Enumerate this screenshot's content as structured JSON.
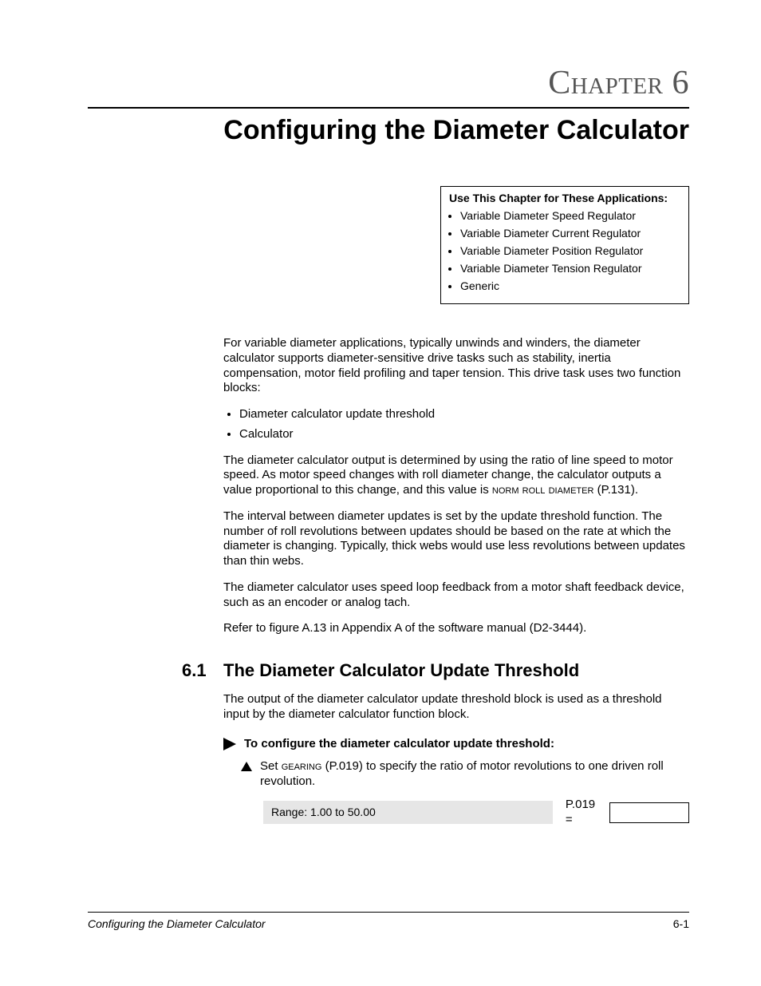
{
  "chapter": {
    "label": "Chapter",
    "number": "6",
    "title": "Configuring the Diameter Calculator"
  },
  "apps_box": {
    "title": "Use This Chapter for These Applications:",
    "items": [
      "Variable Diameter Speed Regulator",
      "Variable Diameter Current Regulator",
      "Variable Diameter Position Regulator",
      "Variable Diameter Tension Regulator",
      "Generic"
    ]
  },
  "intro": {
    "p1": "For variable diameter applications, typically unwinds and winders, the diameter calculator supports diameter-sensitive drive tasks such as stability, inertia compensation, motor field profiling and taper tension. This drive task uses two function blocks:",
    "bullets": [
      "Diameter calculator update threshold",
      "Calculator"
    ],
    "p2a": "The diameter calculator output is determined by using the ratio of line speed to motor speed. As motor speed changes with roll diameter change, the calculator outputs a value proportional to this change, and this value is ",
    "p2_param": "norm roll diameter",
    "p2b": " (P.131).",
    "p3": "The interval between diameter updates is set by the update threshold function. The number of roll revolutions between updates should be based on the rate at which the diameter is changing. Typically, thick webs would use less revolutions between updates than thin webs.",
    "p4": "The diameter calculator uses speed loop feedback from a motor shaft feedback device, such as an encoder or analog tach.",
    "p5": "Refer to figure A.13 in Appendix A of the software manual (D2-3444)."
  },
  "section": {
    "number": "6.1",
    "title": "The Diameter Calculator Update Threshold",
    "p1": "The output of the diameter calculator update threshold block is used as a threshold input by the diameter calculator function block.",
    "proc_title": "To configure the diameter calculator update threshold:",
    "step1a": "Set ",
    "step1_param": "gearing",
    "step1b": " (P.019) to specify the ratio of motor revolutions to one driven roll revolution.",
    "range_text": "Range: 1.00 to 50.00",
    "param_label": "P.019 ="
  },
  "footer": {
    "left": "Configuring the Diameter Calculator",
    "right": "6-1"
  }
}
